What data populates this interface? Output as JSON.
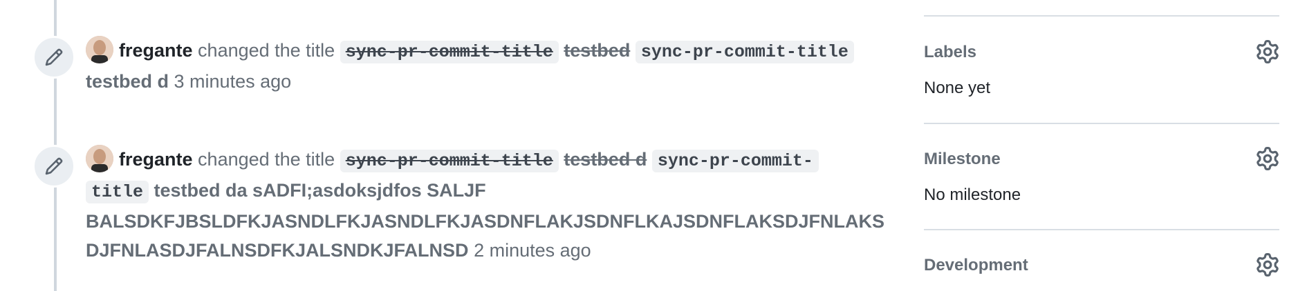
{
  "timeline": {
    "events": [
      {
        "author": "fregante",
        "action": "changed the title",
        "old_title_code": "sync-pr-commit-title",
        "old_title_text": "testbed",
        "new_title_code": "sync-pr-commit-title",
        "new_title_text": "testbed d",
        "time": "3 minutes ago",
        "icon": "pencil-icon"
      },
      {
        "author": "fregante",
        "action": "changed the title",
        "old_title_code": "sync-pr-commit-title",
        "old_title_text": "testbed d",
        "new_title_code_1": "sync-pr-commit-",
        "new_title_code_2": "title",
        "new_title_text_1": "testbed da sADFI;asdoksjdfos SALJF",
        "new_title_text_2": "BALSDKFJBSLDFKJASNDLFKJASNDLFKJASDNFLAKJSDNFLKAJSDNFLAKSDJFNLAKS",
        "new_title_text_3": "DJFNLASDJFALNSDFKJALSNDKJFALNSD",
        "time": "2 minutes ago",
        "icon": "pencil-icon"
      }
    ]
  },
  "sidebar": {
    "labels": {
      "heading": "Labels",
      "value": "None yet",
      "icon": "gear-icon"
    },
    "milestone": {
      "heading": "Milestone",
      "value": "No milestone",
      "icon": "gear-icon"
    },
    "development": {
      "heading": "Development",
      "icon": "gear-icon"
    }
  }
}
